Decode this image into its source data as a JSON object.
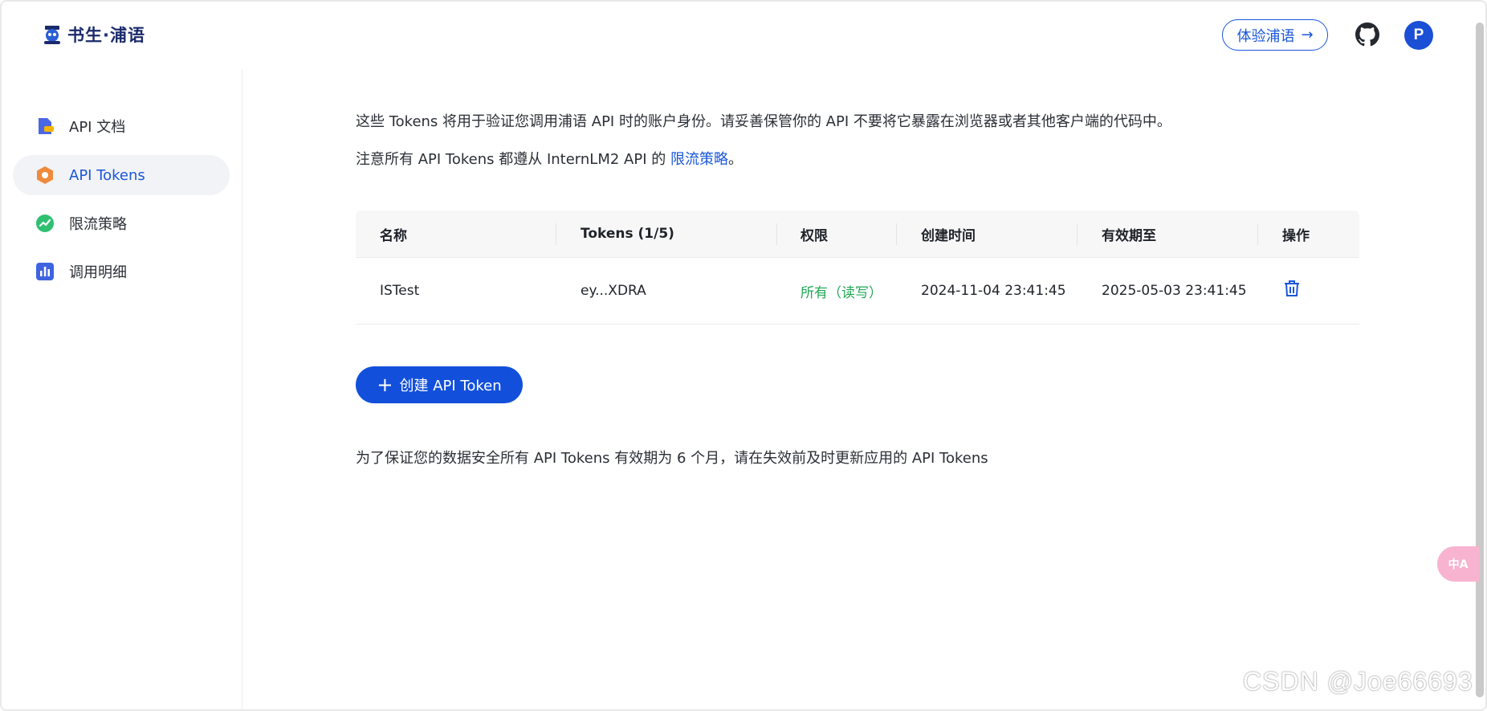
{
  "header": {
    "logo_text": "书生·浦语",
    "try_button": "体验浦语",
    "try_arrow": "→",
    "avatar_letter": "P"
  },
  "sidebar": {
    "items": [
      {
        "label": "API 文档",
        "icon": "document-icon",
        "active": false
      },
      {
        "label": "API Tokens",
        "icon": "hexagon-token-icon",
        "active": true
      },
      {
        "label": "限流策略",
        "icon": "trend-icon",
        "active": false
      },
      {
        "label": "调用明细",
        "icon": "bar-chart-icon",
        "active": false
      }
    ]
  },
  "main": {
    "intro": "这些 Tokens 将用于验证您调用浦语 API 时的账户身份。请妥善保管你的 API 不要将它暴露在浏览器或者其他客户端的代码中。",
    "notice_prefix": "注意所有 API Tokens 都遵从 InternLM2 API 的 ",
    "notice_link": "限流策略",
    "notice_suffix": "。",
    "table": {
      "headers": [
        "名称",
        "Tokens (1/5)",
        "权限",
        "创建时间",
        "有效期至",
        "操作"
      ],
      "rows": [
        {
          "name": "ISTest",
          "token": "ey...XDRA",
          "permission": "所有（读写）",
          "created": "2024-11-04 23:41:45",
          "expires": "2025-05-03 23:41:45",
          "action_icon": "trash-icon"
        }
      ]
    },
    "create_button": "创建 API Token",
    "create_plus": "+",
    "footer_note": "为了保证您的数据安全所有 API Tokens 有效期为 6 个月，请在失效前及时更新应用的 API Tokens"
  },
  "translate_fab": "中A",
  "watermark": "CSDN @Joe66693",
  "colors": {
    "accent": "#1a56db",
    "button_bg": "#1250dc",
    "permission_green": "#1fa855",
    "active_nav_bg": "#f2f3f6"
  }
}
